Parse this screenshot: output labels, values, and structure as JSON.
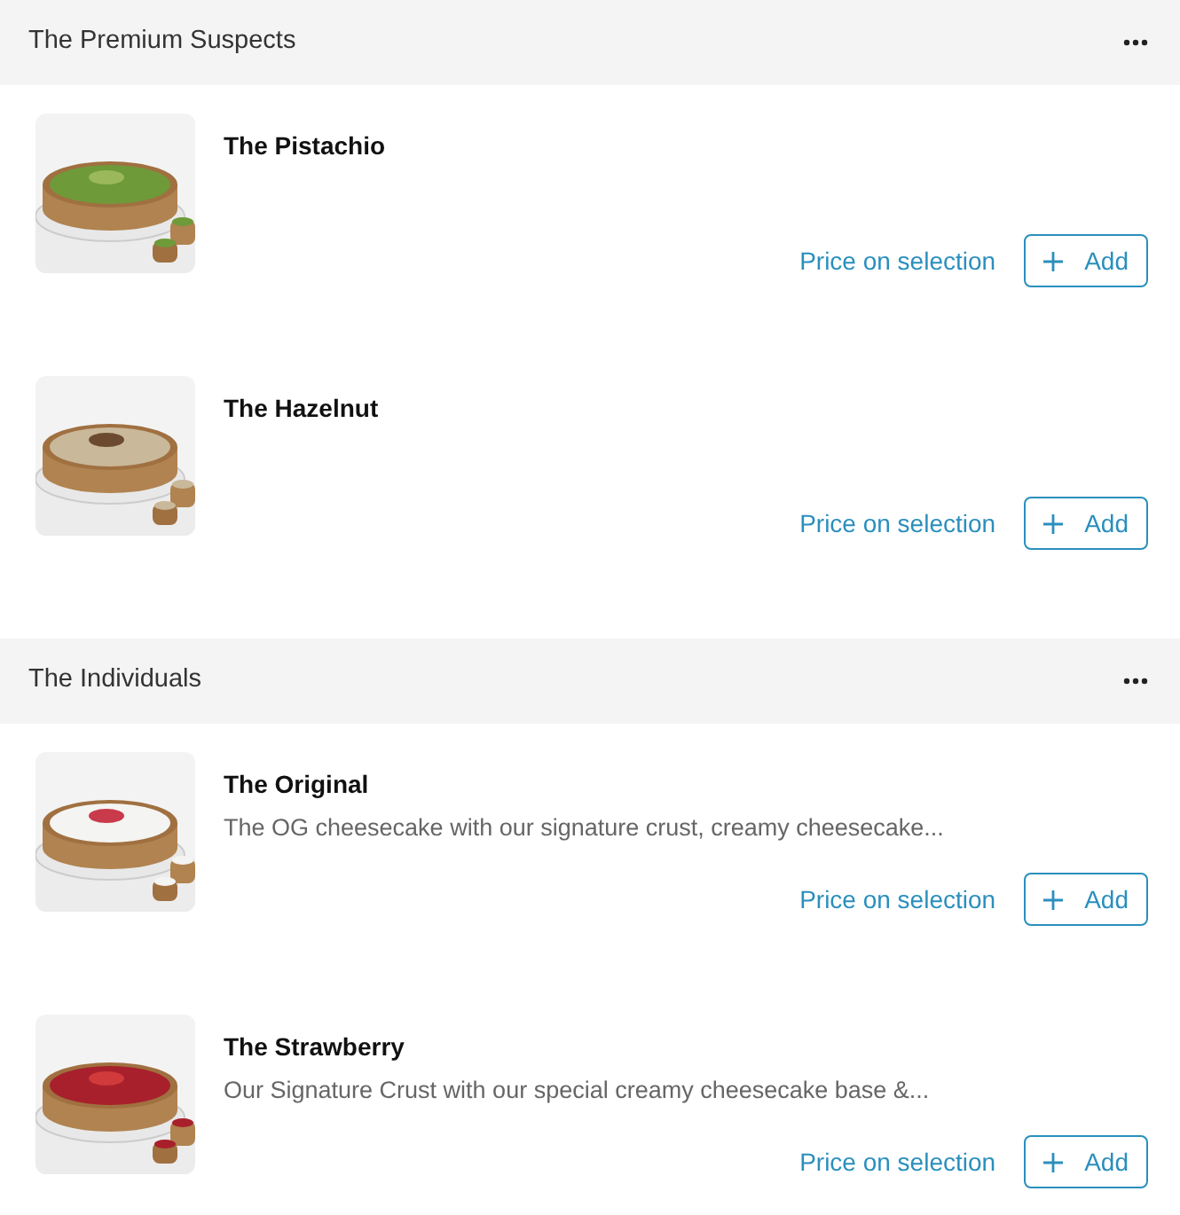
{
  "sections": [
    {
      "title": "The Premium Suspects",
      "items": [
        {
          "name": "The Pistachio",
          "price": "Price on selection",
          "button": "Add"
        },
        {
          "name": "The Hazelnut",
          "price": "Price on selection",
          "button": "Add"
        }
      ]
    },
    {
      "title": "The Individuals",
      "items": [
        {
          "name": "The Original",
          "description": "The OG cheesecake with our signature crust, creamy cheesecake...",
          "price": "Price on selection",
          "button": "Add"
        },
        {
          "name": "The Strawberry",
          "description": "Our Signature Crust with our special creamy cheesecake base &...",
          "price": "Price on selection",
          "button": "Add"
        }
      ]
    }
  ]
}
